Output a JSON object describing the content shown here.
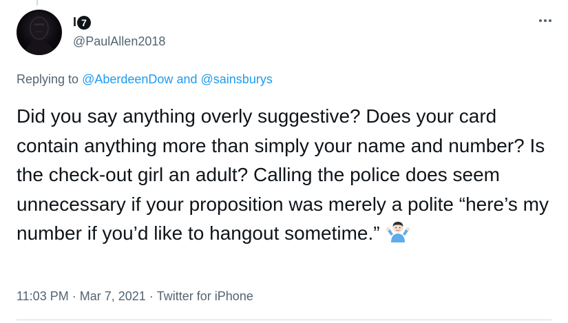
{
  "author": {
    "display_name": "I",
    "display_name_badge": "7",
    "handle": "@PaulAllen2018"
  },
  "reply_context": {
    "prefix": "Replying to",
    "user_1": "@AberdeenDow",
    "joiner": "and",
    "user_2": "@sainsburys"
  },
  "tweet": {
    "text": "Did you say anything overly suggestive? Does your card contain anything more than simply your name and number? Is the check-out girl an adult? Calling the police does seem unnecessary if your proposition was merely a polite “here’s my number if you’d like to hangout sometime.”",
    "emoji": "man-shrugging"
  },
  "meta": {
    "time": "11:03 PM",
    "separator": "·",
    "date": "Mar 7, 2021",
    "source": "Twitter for iPhone"
  },
  "icons": {
    "more": "more-dots-icon",
    "emoji": "man-shrugging-emoji"
  },
  "colors": {
    "text": "#0f1419",
    "secondary": "#536471",
    "link": "#1d9bf0",
    "border": "#cfd9de"
  }
}
